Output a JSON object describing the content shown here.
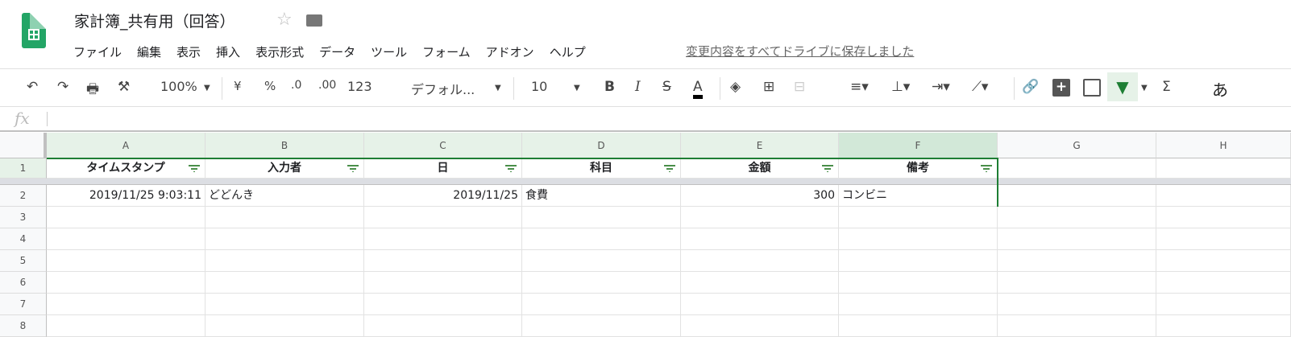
{
  "doc": {
    "title": "家計簿_共有用（回答）",
    "saved": "変更内容をすべてドライブに保存しました"
  },
  "menu": [
    "ファイル",
    "編集",
    "表示",
    "挿入",
    "表示形式",
    "データ",
    "ツール",
    "フォーム",
    "アドオン",
    "ヘルプ"
  ],
  "toolbar": {
    "zoom": "100%",
    "currency": "¥",
    "percent": "%",
    "dec_less": ".0",
    "dec_more": ".00",
    "format": "123",
    "font": "デフォル...",
    "size": "10",
    "bold": "B",
    "italic": "I",
    "strike": "S",
    "textcolor": "A",
    "input": "あ",
    "sum": "Σ"
  },
  "formula": {
    "label": "fx",
    "value": ""
  },
  "columns": [
    "A",
    "B",
    "C",
    "D",
    "E",
    "F",
    "G",
    "H"
  ],
  "rows": [
    "1",
    "2",
    "3",
    "4",
    "5",
    "6",
    "7",
    "8"
  ],
  "headers": [
    "タイムスタンプ",
    "入力者",
    "日",
    "科目",
    "金額",
    "備考"
  ],
  "data": [
    [
      "2019/11/25 9:03:11",
      "どどんき",
      "2019/11/25",
      "食費",
      "300",
      "コンビニ"
    ]
  ],
  "colors": {
    "accent": "#1e7e34",
    "selected_header": "#d2e8d8",
    "header_tint": "#e6f2e8"
  }
}
